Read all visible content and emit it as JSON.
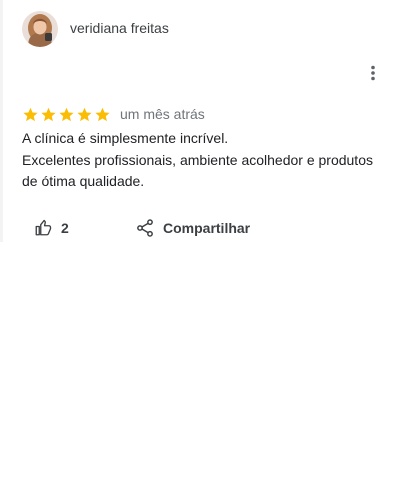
{
  "review": {
    "reviewer_name": "veridiana freitas",
    "avatar_icon": "profile-photo",
    "rating": 5,
    "rating_max": 5,
    "star_color": "#fbbc04",
    "time_ago": "um mês atrás",
    "text_lines": [
      "A clínica é simplesmente incrível.",
      "Excelentes profissionais, ambiente acolhedor e produtos",
      "de ótima qualidade."
    ],
    "menu_icon": "more-vertical-icon"
  },
  "actions": {
    "like_icon": "thumbs-up-icon",
    "like_count": "2",
    "share_icon": "share-icon",
    "share_label": "Compartilhar"
  }
}
